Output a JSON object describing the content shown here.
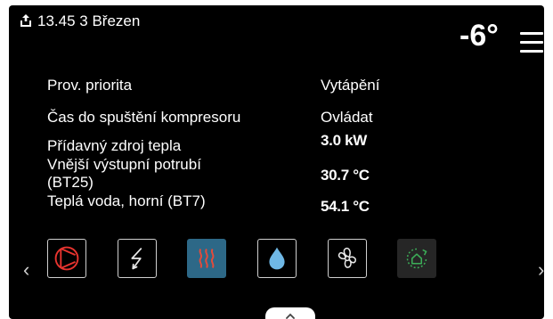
{
  "status": {
    "text": "13.45 3 Březen",
    "icon": "upload-box-icon"
  },
  "header": {
    "outdoor_temp": "-6°",
    "menu_icon": "hamburger-menu-icon"
  },
  "info_rows": [
    {
      "label": "Prov. priorita",
      "value": "Vytápění"
    },
    {
      "label": "Čas do spuštění kompresoru",
      "value": "Ovládat"
    },
    {
      "label": "Přídavný zdroj tepla",
      "value": "3.0 kW"
    },
    {
      "label": "Vnější výstupní potrubí (BT25)",
      "value": "30.7 °C"
    },
    {
      "label": "Teplá voda, horní (BT7)",
      "value": "54.1 °C"
    }
  ],
  "nav": {
    "prev": "‹",
    "next": "›"
  },
  "tiles": [
    {
      "icon": "compressor-icon",
      "state": "normal"
    },
    {
      "icon": "electric-addition-icon",
      "state": "normal"
    },
    {
      "icon": "heating-icon",
      "state": "selected"
    },
    {
      "icon": "hot-water-drop-icon",
      "state": "normal"
    },
    {
      "icon": "ventilation-fan-icon",
      "state": "normal"
    },
    {
      "icon": "smart-home-icon",
      "state": "disabled"
    }
  ],
  "colors": {
    "background": "#000000",
    "text": "#ffffff",
    "accent_selected": "#2d6887",
    "compressor_red": "#e8342f",
    "water_blue": "#6fb8e6",
    "heating_red": "#e34b3b",
    "smart_green": "#3cae58"
  }
}
